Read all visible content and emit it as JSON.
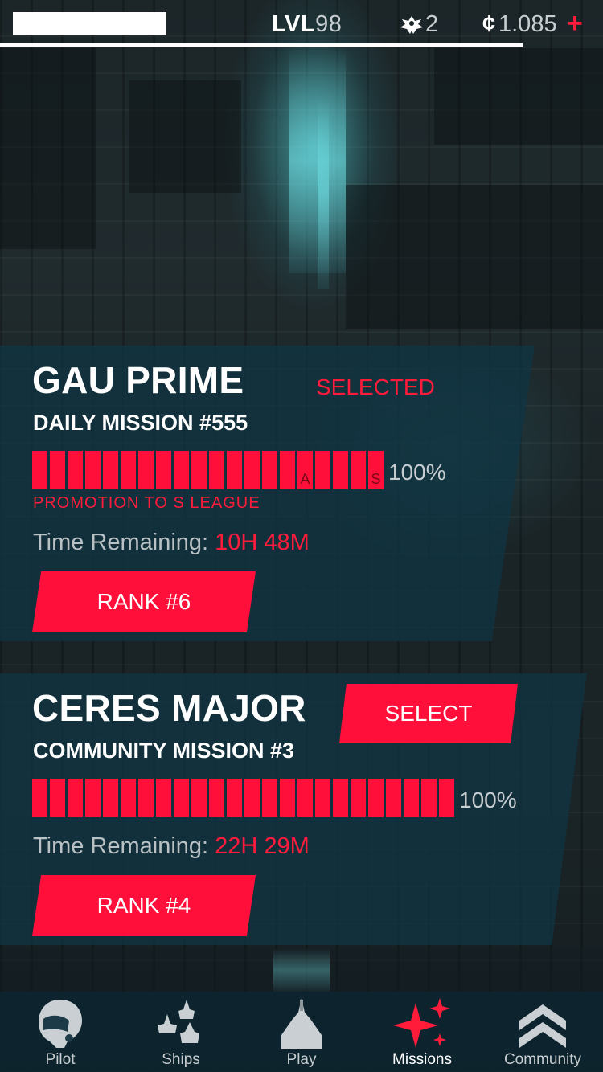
{
  "header": {
    "lvl_prefix": "LVL",
    "lvl_value": "98",
    "wings_count": "2",
    "credits_symbol": "¢",
    "credits_value": "1.085",
    "plus_label": "+"
  },
  "missions": [
    {
      "title": "GAU PRIME",
      "subtitle": "DAILY MISSION #555",
      "status": "SELECTED",
      "progress_percent": 100,
      "progress_label": "100%",
      "segment_markers": [
        "A",
        "S"
      ],
      "promotion": "PROMOTION TO S LEAGUE",
      "time_label": "Time Remaining:",
      "time_value": "10H 48M",
      "rank": "RANK #6"
    },
    {
      "title": "CERES MAJOR",
      "subtitle": "COMMUNITY MISSION #3",
      "action": "SELECT",
      "progress_percent": 100,
      "progress_label": "100%",
      "time_label": "Time Remaining:",
      "time_value": "22H 29M",
      "rank": "RANK #4"
    }
  ],
  "nav": {
    "items": [
      {
        "label": "Pilot",
        "icon": "pilot-helmet-icon"
      },
      {
        "label": "Ships",
        "icon": "ships-icon"
      },
      {
        "label": "Play",
        "icon": "play-ship-icon"
      },
      {
        "label": "Missions",
        "icon": "missions-star-icon",
        "active": true
      },
      {
        "label": "Community",
        "icon": "community-chevron-icon"
      }
    ]
  },
  "colors": {
    "accent": "#ff0f39",
    "panel": "#10344a",
    "muted_text": "#c7cdd0"
  }
}
